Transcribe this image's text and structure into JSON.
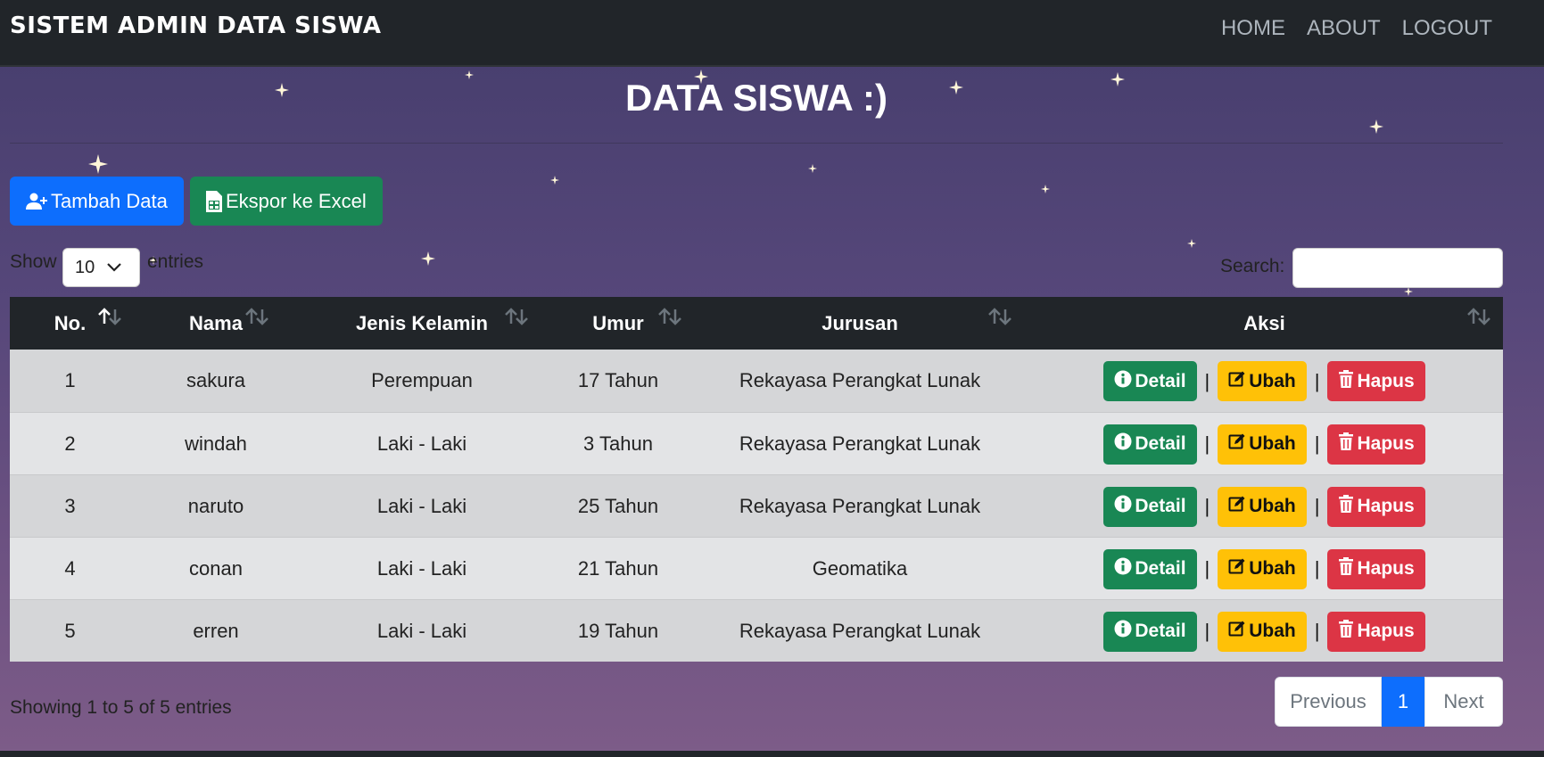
{
  "navbar": {
    "brand": "SISTEM ADMIN DATA SISWA",
    "links": [
      "HOME",
      "ABOUT",
      "LOGOUT"
    ]
  },
  "page_title": "DATA SISWA :)",
  "buttons": {
    "add": "Tambah Data",
    "export": "Ekspor ke Excel"
  },
  "length_control": {
    "show_label": "Show",
    "selected": "10",
    "entries_label": "entries"
  },
  "search": {
    "label": "Search:",
    "value": ""
  },
  "table": {
    "headers": [
      "No.",
      "Nama",
      "Jenis Kelamin",
      "Umur",
      "Jurusan",
      "Aksi"
    ],
    "rows": [
      {
        "no": "1",
        "nama": "sakura",
        "jk": "Perempuan",
        "umur": "17 Tahun",
        "jurusan": "Rekayasa Perangkat Lunak"
      },
      {
        "no": "2",
        "nama": "windah",
        "jk": "Laki - Laki",
        "umur": "3 Tahun",
        "jurusan": "Rekayasa Perangkat Lunak"
      },
      {
        "no": "3",
        "nama": "naruto",
        "jk": "Laki - Laki",
        "umur": "25 Tahun",
        "jurusan": "Rekayasa Perangkat Lunak"
      },
      {
        "no": "4",
        "nama": "conan",
        "jk": "Laki - Laki",
        "umur": "21 Tahun",
        "jurusan": "Geomatika"
      },
      {
        "no": "5",
        "nama": "erren",
        "jk": "Laki - Laki",
        "umur": "19 Tahun",
        "jurusan": "Rekayasa Perangkat Lunak"
      }
    ],
    "actions": {
      "detail": "Detail",
      "ubah": "Ubah",
      "hapus": "Hapus",
      "separator": "|"
    }
  },
  "info": "Showing 1 to 5 of 5 entries",
  "pagination": {
    "previous": "Previous",
    "current": "1",
    "next": "Next"
  },
  "colors": {
    "navbar": "#212529",
    "primary": "#0d6efd",
    "success": "#198754",
    "warning": "#ffc107",
    "danger": "#dc3545"
  }
}
